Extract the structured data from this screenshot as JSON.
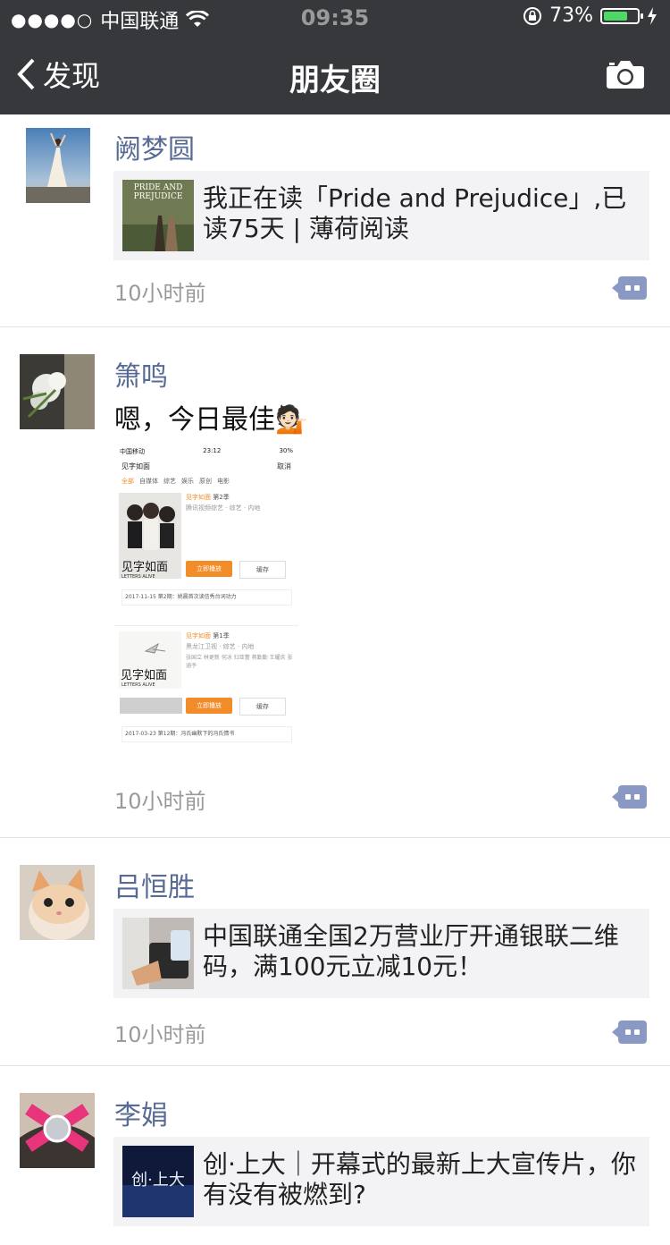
{
  "status_bar": {
    "signal": "●●●●○",
    "carrier": "中国联通",
    "time": "09:35",
    "battery_percent": "73%",
    "battery_level": 0.73
  },
  "nav": {
    "back_label": "发现",
    "title": "朋友圈"
  },
  "posts": [
    {
      "name": "阙梦圆",
      "link_thumb_text": "PRIDE AND PREJUDICE",
      "link_text": "我正在读「Pride and Prejudice」,已读75天 | 薄荷阅读",
      "time": "10小时前"
    },
    {
      "name": "箫鸣",
      "text": "嗯，今日最佳💁🏻",
      "screenshot": {
        "carrier": "中国移动",
        "time": "23:12",
        "battery": "30%",
        "search_value": "见字如面",
        "cancel": "取消",
        "tabs": [
          "全部",
          "自媒体",
          "综艺",
          "娱乐",
          "原创",
          "电影"
        ],
        "items": [
          {
            "title": "见字如面",
            "season": "第2季",
            "meta1": "腾讯视频综艺 · 综艺 · 内地",
            "poster_text": "见字如面",
            "poster_sub": "LETTERS ALIVE",
            "play": "立即播放",
            "cache": "缓存",
            "episode": "2017-11-15 第2期：姚晨首次读信秀台词功力"
          },
          {
            "title": "见字如面",
            "season": "第1季",
            "meta1": "黑龙江卫视 · 综艺 · 内地",
            "meta2": "张国立 林更新 何冰 归亚蕾 蒋勤勤 王耀庆 张涵予",
            "poster_text": "见字如面",
            "poster_sub": "LETTERS ALIVE",
            "play": "立即播放",
            "cache": "缓存",
            "episode": "2017-03-23 第12期：冯氏幽默下的冯氏情书"
          }
        ]
      },
      "time": "10小时前"
    },
    {
      "name": "吕恒胜",
      "link_text": "中国联通全国2万营业厅开通银联二维码，满100元立减10元！",
      "time": "10小时前"
    },
    {
      "name": "李娟",
      "link_text": "创·上大｜开幕式的最新上大宣传片，你有没有被燃到?",
      "link_thumb_text": "创·上大"
    }
  ],
  "colors": {
    "bar_bg": "#36383c",
    "name_color": "#576b95",
    "link_bg": "#f3f3f5",
    "accent_orange": "#f28c28"
  }
}
